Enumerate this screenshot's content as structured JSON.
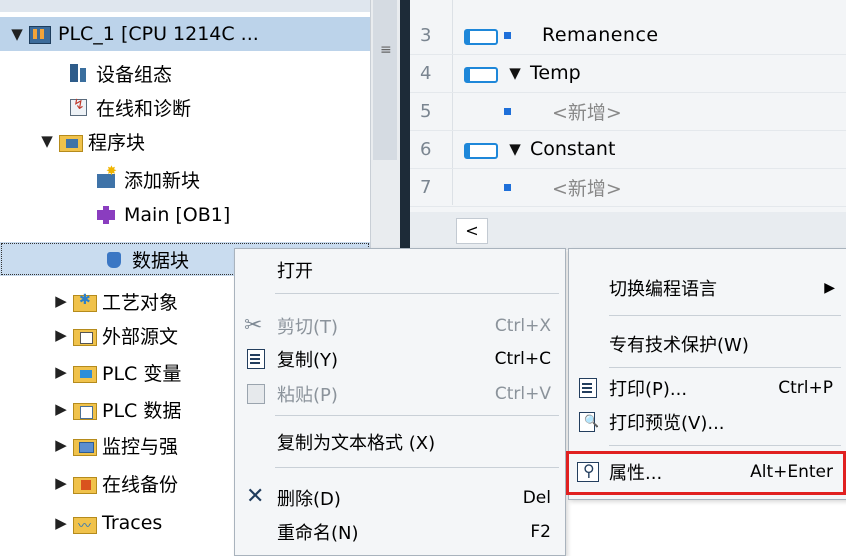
{
  "tree": {
    "items": [
      {
        "label": "PLC_1 [CPU 1214C ...",
        "twisty": "▼",
        "icon": "plc-icon"
      },
      {
        "label": "设备组态",
        "twisty": "",
        "icon": "device-config-icon"
      },
      {
        "label": "在线和诊断",
        "twisty": "",
        "icon": "online-diagnostics-icon"
      },
      {
        "label": "程序块",
        "twisty": "▼",
        "icon": "program-blocks-folder-icon"
      },
      {
        "label": "添加新块",
        "twisty": "",
        "icon": "add-new-block-icon"
      },
      {
        "label": "Main [OB1]",
        "twisty": "",
        "icon": "ob-block-icon"
      },
      {
        "label": "数据块",
        "twisty": "",
        "icon": "data-block-icon"
      },
      {
        "label": "工艺对象",
        "twisty": "▶",
        "icon": "technology-objects-folder-icon"
      },
      {
        "label": "外部源文",
        "twisty": "▶",
        "icon": "external-sources-folder-icon"
      },
      {
        "label": "PLC 变量",
        "twisty": "▶",
        "icon": "plc-tags-folder-icon"
      },
      {
        "label": "PLC 数据",
        "twisty": "▶",
        "icon": "plc-data-types-folder-icon"
      },
      {
        "label": "监控与强",
        "twisty": "▶",
        "icon": "watch-force-folder-icon"
      },
      {
        "label": "在线备份",
        "twisty": "▶",
        "icon": "online-backups-folder-icon"
      },
      {
        "label": "Traces",
        "twisty": "▶",
        "icon": "traces-folder-icon"
      }
    ]
  },
  "splitter": {
    "grip": "≡"
  },
  "table": {
    "rows": [
      {
        "num": "3",
        "name": "Remanence"
      },
      {
        "num": "4",
        "twisty": "▼",
        "name": "Temp"
      },
      {
        "num": "5",
        "name": "<新增>"
      },
      {
        "num": "6",
        "twisty": "▼",
        "name": "Constant"
      },
      {
        "num": "7",
        "name": "<新增>"
      }
    ],
    "scroll_left": "<"
  },
  "context_menu": {
    "open": "打开",
    "cut": "剪切(T)",
    "cut_shortcut": "Ctrl+X",
    "copy": "复制(Y)",
    "copy_shortcut": "Ctrl+C",
    "paste": "粘贴(P)",
    "paste_shortcut": "Ctrl+V",
    "copy_as_text": "复制为文本格式 (X)",
    "delete": "删除(D)",
    "delete_shortcut": "Del",
    "rename": "重命名(N)",
    "rename_shortcut": "F2"
  },
  "submenu": {
    "switch_language": "切换编程语言",
    "switch_arrow": "▶",
    "know_how_protection": "专有技术保护(W)",
    "print": "打印(P)...",
    "print_shortcut": "Ctrl+P",
    "print_preview": "打印预览(V)...",
    "properties": "属性...",
    "properties_shortcut": "Alt+Enter"
  },
  "colors": {
    "selection": "#c9dcef",
    "highlight_box": "#e02020",
    "menu_bg": "#f4f6f8"
  }
}
